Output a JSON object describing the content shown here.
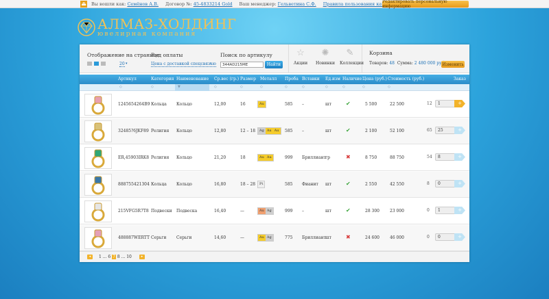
{
  "topbar": {
    "logged_label": "Вы вошли как:",
    "user": "Семёнов А.В.",
    "contract_label": "Договор №:",
    "contract": "45-4833214 Gold",
    "manager_label": "Ваш менеджер:",
    "manager": "Гельветина С.Ф.",
    "rules_link": "Правила пользования каталогом",
    "edit_button": "Редактировать персональную информацию"
  },
  "brand": {
    "name": "АЛМАЗ-ХОЛДИНГ",
    "sub": "ювелирная компания"
  },
  "controls": {
    "per_page_label": "Отображение на странице",
    "per_page_value": "20",
    "payment_label": "Вид оплаты",
    "payment_value": "Цена с доставкой спецсвязью",
    "search_label": "Поиск по артикулу",
    "search_value": "344AD215ME",
    "search_button": "Найти",
    "tools": [
      "Акции",
      "Новинки",
      "Коллекции"
    ]
  },
  "basket": {
    "title": "Корзина",
    "items_label": "Товаров:",
    "items": "48",
    "sum_label": "Сумма:",
    "sum": "2 480 000 руб.",
    "change_button": "Изменить"
  },
  "table": {
    "headers": [
      "Артикул",
      "Категория",
      "Наименование",
      "Ср.вес (гр.)",
      "Размер",
      "Металл",
      "Проба",
      "Вставки",
      "Ед.изм",
      "Наличие",
      "Цена (руб.)",
      "Стоимость (руб.)",
      "Заказ"
    ],
    "rows": [
      {
        "article": "1245654264В9",
        "category": "Кольца",
        "name": "Кольцо",
        "weight": "12,00",
        "size": "16",
        "metal": [
          "Au"
        ],
        "probe": "585",
        "insert": "–",
        "unit": "шт",
        "stock": true,
        "price": "5 500",
        "cost": "22 500",
        "order_n": "12",
        "order_v": "1",
        "active": true
      },
      {
        "article": "32485?6JKF89",
        "category": "Религия",
        "name": "Кольцо",
        "weight": "12,80",
        "size": "12 – 18",
        "metal": [
          "Ag",
          "Au",
          "Au"
        ],
        "probe": "585",
        "insert": "–",
        "unit": "шт",
        "stock": true,
        "price": "2 100",
        "cost": "52 100",
        "order_n": "65",
        "order_v": "25",
        "active": false
      },
      {
        "article": "ER,45903IRK8",
        "category": "Религия",
        "name": "Кольцо",
        "weight": "21,20",
        "size": "18",
        "metal": [
          "Au",
          "Au"
        ],
        "probe": "999",
        "insert": "Бриллиант",
        "unit": "гр",
        "stock": false,
        "price": "8 750",
        "cost": "88 750",
        "order_n": "54",
        "order_v": "8",
        "active": false
      },
      {
        "article": "888755421304",
        "category": "Кольца",
        "name": "Кольцо",
        "weight": "16,80",
        "size": "18 – 28",
        "metal": [
          "Pt"
        ],
        "probe": "585",
        "insert": "Фианит",
        "unit": "шт",
        "stock": true,
        "price": "2 550",
        "cost": "42 550",
        "order_n": "8",
        "order_v": "0",
        "active": false
      },
      {
        "article": "215VFG5R7T8",
        "category": "Подвески",
        "name": "Подвеска",
        "weight": "16,40",
        "size": "—",
        "metal": [
          "Au",
          "Ag"
        ],
        "probe": "999",
        "insert": "–",
        "unit": "шт",
        "stock": true,
        "price": "28 300",
        "cost": "23 000",
        "order_n": "0",
        "order_v": "1",
        "active": false
      },
      {
        "article": "488887WERTT",
        "category": "Серьги",
        "name": "Серьги",
        "weight": "14,60",
        "size": "—",
        "metal": [
          "Au",
          "Ag"
        ],
        "probe": "775",
        "insert": "Бриллиант",
        "unit": "шт",
        "stock": false,
        "price": "24 600",
        "cost": "46 000",
        "order_n": "0",
        "order_v": "0",
        "active": false
      }
    ]
  },
  "pager": {
    "pages": "1 ... 6",
    "current": "7",
    "rest": "8 ... 10"
  }
}
